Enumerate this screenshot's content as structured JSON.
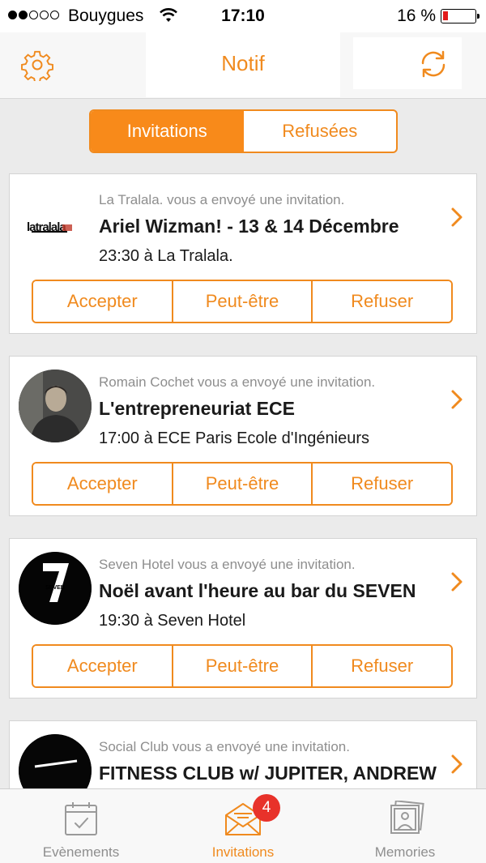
{
  "status_bar": {
    "carrier": "Bouygues",
    "time": "17:10",
    "battery": "16 %",
    "signal_bars": 2
  },
  "nav": {
    "title": "Notif",
    "left_icon": "gear-icon",
    "right_icon": "refresh-icon"
  },
  "segments": [
    {
      "label": "Invitations",
      "active": true
    },
    {
      "label": "Refusées",
      "active": false
    }
  ],
  "actions": {
    "accept": "Accepter",
    "maybe": "Peut-être",
    "refuse": "Refuser"
  },
  "invitations": [
    {
      "sender": "La Tralala. vous a envoyé une invitation.",
      "title": "Ariel Wizman! - 13 & 14 Décembre",
      "time": "23:30 à La Tralala.",
      "avatar_logo": "latralala"
    },
    {
      "sender": "Romain Cochet vous a envoyé une invitation.",
      "title": "L'entrepreneuriat ECE",
      "time": "17:00 à ECE Paris Ecole d'Ingénieurs"
    },
    {
      "sender": "Seven Hotel vous a envoyé une invitation.",
      "title": "Noël avant l'heure au bar du SEVEN",
      "time": "19:30 à Seven Hotel",
      "avatar_logo": "SEVEN"
    },
    {
      "sender": "Social Club vous a envoyé une invitation.",
      "title": "FITNESS CLUB w/ JUPITER, ANDREW",
      "time": ""
    }
  ],
  "tabs": [
    {
      "label": "Evènements",
      "icon": "calendar-icon",
      "active": false
    },
    {
      "label": "Invitations",
      "icon": "envelope-icon",
      "active": true,
      "badge": "4"
    },
    {
      "label": "Memories",
      "icon": "photos-icon",
      "active": false
    }
  ],
  "colors": {
    "accent": "#f08a1e",
    "badge": "#e8322a",
    "background": "#ebebeb"
  }
}
